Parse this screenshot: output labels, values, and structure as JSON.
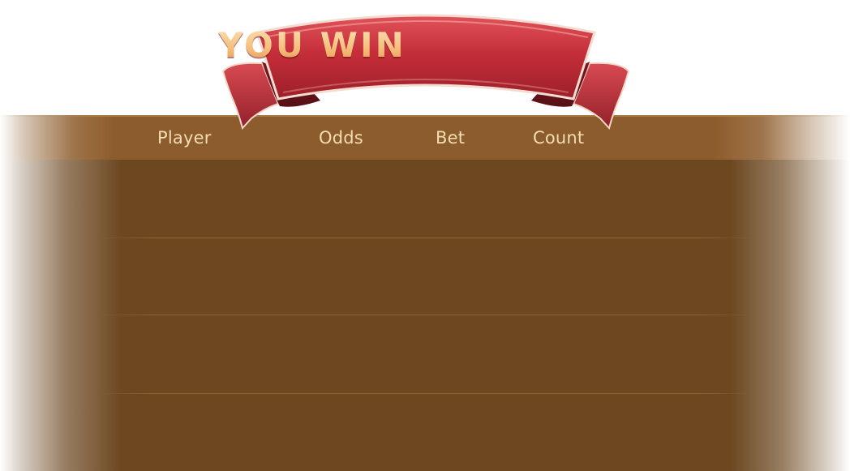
{
  "banner": {
    "title": "YOU WIN"
  },
  "table": {
    "columns": [
      "Player",
      "Odds",
      "Bet",
      "Count"
    ],
    "rows": []
  },
  "colors": {
    "ribbon_red": "#c62f3b",
    "ribbon_dark": "#8f1e27",
    "header_bg": "#8d5c2c",
    "body_bg": "#6c4720",
    "header_text": "#f3dcb2",
    "title_gold": "#f5c07e"
  }
}
